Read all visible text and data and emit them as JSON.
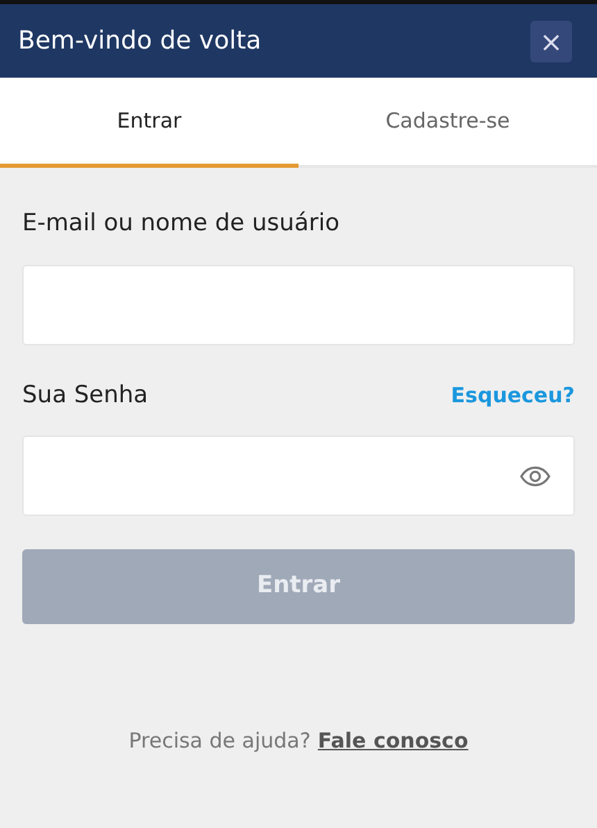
{
  "header": {
    "title": "Bem-vindo de volta",
    "close": "×"
  },
  "tabs": [
    {
      "label": "Entrar",
      "selected": true
    },
    {
      "label": "Cadastre-se",
      "selected": false
    }
  ],
  "form": {
    "username_label": "E-mail ou nome de usuário",
    "password_label": "Sua Senha",
    "forgot_link": "Esqueceu?",
    "submit": {
      "label": "Entrar",
      "disabled": true
    }
  },
  "help": {
    "text": "Precisa de ajuda?",
    "link": "Fale conosco"
  }
}
